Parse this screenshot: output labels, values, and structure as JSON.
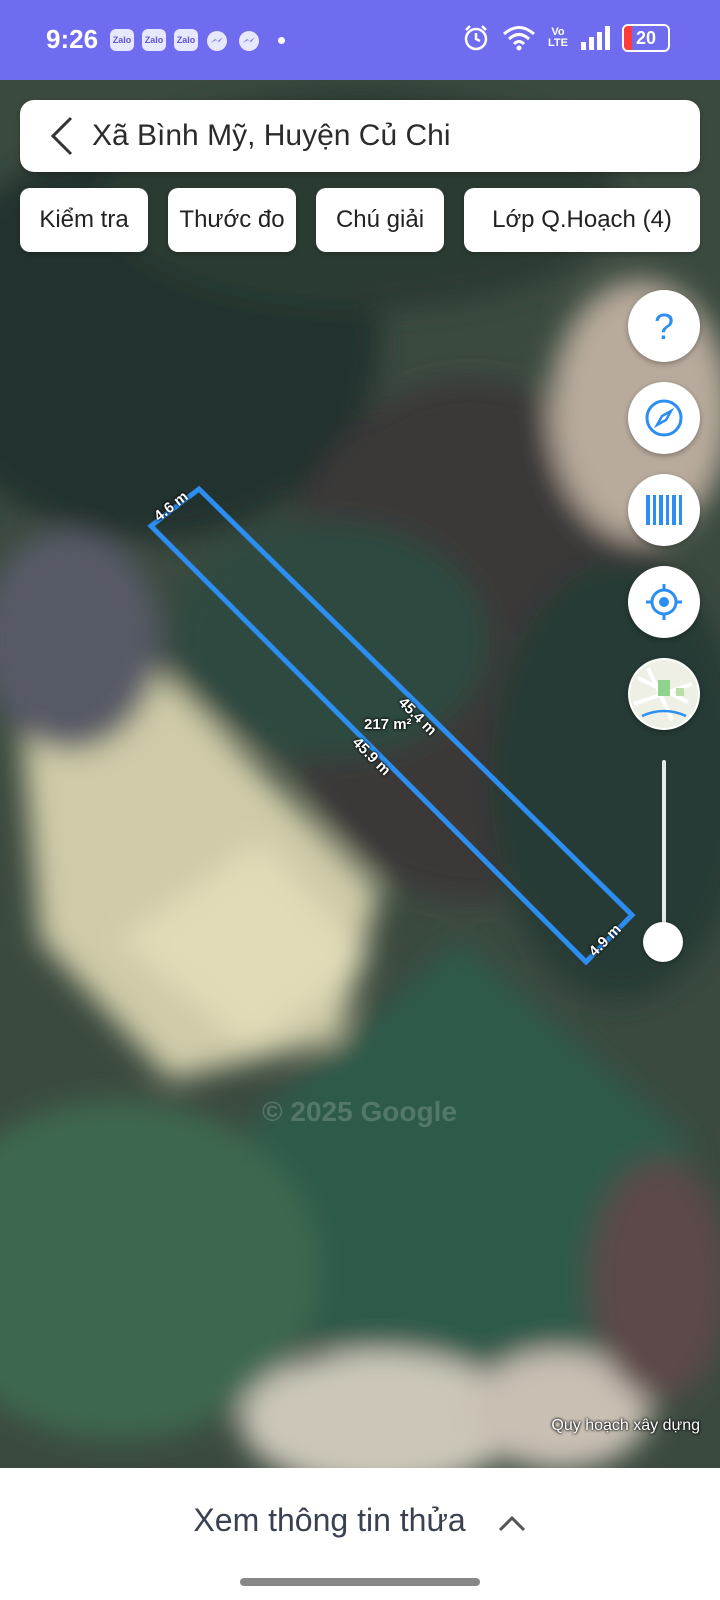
{
  "status_bar": {
    "time": "9:26",
    "notifications": [
      "Zalo",
      "Zalo",
      "Zalo",
      "messenger-icon",
      "messenger-icon"
    ],
    "volte": "Vo\nLTE",
    "battery": "20"
  },
  "header": {
    "title": "Xã Bình Mỹ, Huyện Củ Chi"
  },
  "toolbar": {
    "check": "Kiểm tra",
    "ruler": "Thước đo",
    "legend": "Chú giải",
    "layers": "Lớp Q.Hoạch (4)"
  },
  "map": {
    "watermark": "© 2025 Google",
    "attribution": "Quy hoạch xây dựng",
    "parcel": {
      "area": "217 m²",
      "edge_top": "4.6 m",
      "edge_right": "45.4 m",
      "edge_left": "45.9 m",
      "edge_bottom": "4.9 m"
    },
    "accent": "#2b8ef0"
  },
  "bottom_sheet": {
    "label": "Xem thông tin thửa"
  }
}
